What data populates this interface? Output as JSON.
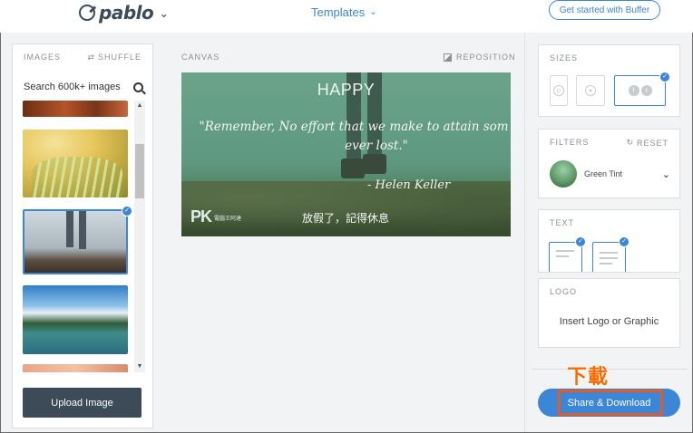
{
  "header": {
    "logo_text": "pablo",
    "templates_label": "Templates",
    "get_started_label": "Get started with Buffer"
  },
  "images_panel": {
    "heading": "IMAGES",
    "shuffle_label": "SHUFFLE",
    "search_placeholder": "Search 600k+ images",
    "upload_label": "Upload Image"
  },
  "canvas": {
    "heading": "CANVAS",
    "reposition_label": "REPOSITION",
    "title": "HAPPY",
    "quote_line1": "\"Remember, No effort that we make to attain som",
    "quote_line2": "ever lost.\"",
    "author": "- Helen Keller",
    "watermark": "PK",
    "watermark_small": "電腦王阿達",
    "caption": "放假了，記得休息"
  },
  "sizes_panel": {
    "heading": "SIZES"
  },
  "filters_panel": {
    "heading": "FILTERS",
    "reset_label": "RESET",
    "selected_filter": "Green Tint"
  },
  "text_panel": {
    "heading": "TEXT"
  },
  "logo_panel": {
    "heading": "LOGO",
    "insert_label": "Insert Logo or Graphic"
  },
  "annotation": "下載",
  "share_download_label": "Share & Download",
  "colors": {
    "accent": "#3b86d6",
    "dark_button": "#3d4a57",
    "annotation": "#ff6a00"
  }
}
